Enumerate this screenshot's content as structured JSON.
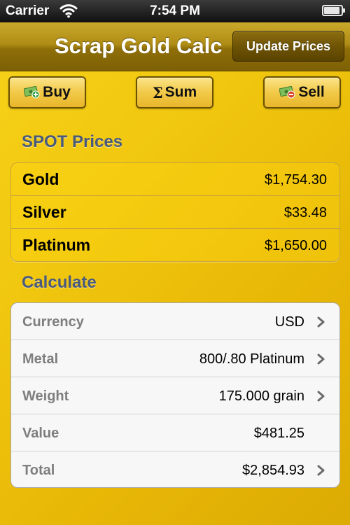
{
  "status_bar": {
    "carrier": "Carrier",
    "time": "7:54 PM",
    "wifi_icon": "wifi-icon",
    "battery_icon": "battery-icon",
    "battery_level": 0.9
  },
  "nav": {
    "title": "Scrap Gold Calc",
    "update_button": "Update Prices"
  },
  "toolbar": {
    "buy_label": "Buy",
    "buy_icon": "money-plus-icon",
    "sum_symbol": "Σ",
    "sum_label": "Sum",
    "sell_label": "Sell",
    "sell_icon": "money-minus-icon"
  },
  "spot": {
    "header": "SPOT Prices",
    "items": [
      {
        "name": "Gold",
        "price": "$1,754.30"
      },
      {
        "name": "Silver",
        "price": "$33.48"
      },
      {
        "name": "Platinum",
        "price": "$1,650.00"
      }
    ]
  },
  "calculate": {
    "header": "Calculate",
    "rows": [
      {
        "label": "Currency",
        "value": "USD",
        "has_chevron": true
      },
      {
        "label": "Metal",
        "value": "800/.80 Platinum",
        "has_chevron": true
      },
      {
        "label": "Weight",
        "value": "175.000 grain",
        "has_chevron": true
      },
      {
        "label": "Value",
        "value": "$481.25",
        "has_chevron": false
      },
      {
        "label": "Total",
        "value": "$2,854.93",
        "has_chevron": true
      }
    ]
  },
  "colors": {
    "background": "#f1c70f",
    "nav_bar": "#a7850f",
    "section_header": "#4a5a7c",
    "button_fill": "#f2c948"
  }
}
